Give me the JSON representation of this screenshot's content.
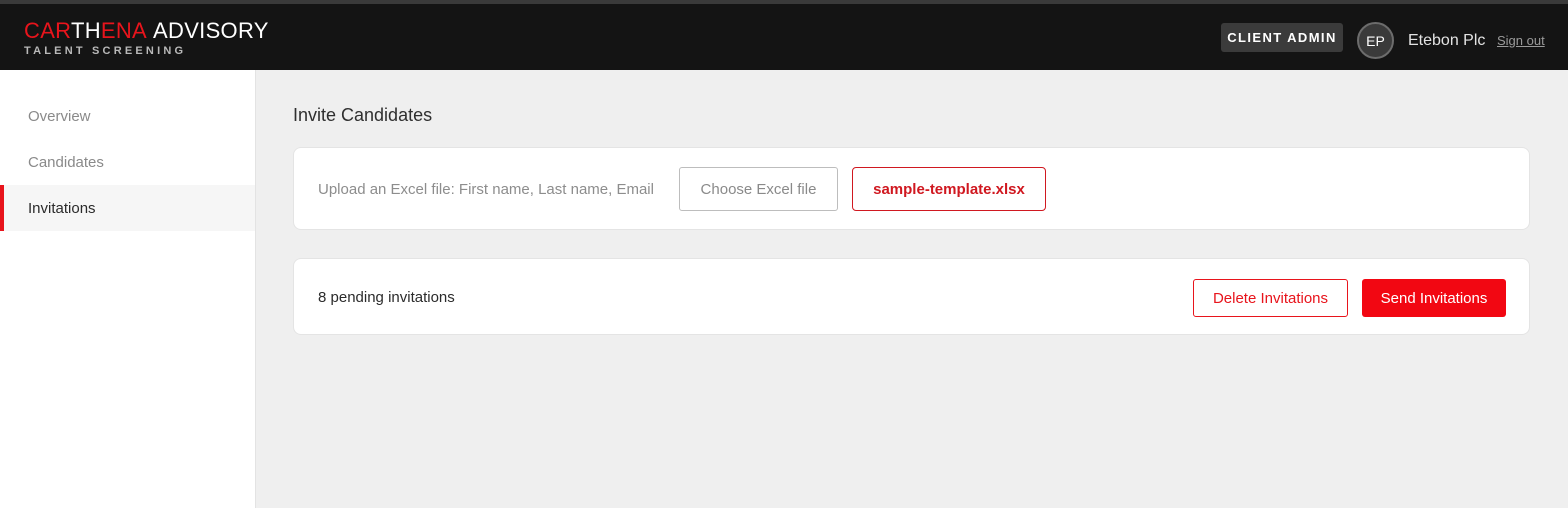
{
  "brand": {
    "name_part1": "CAR",
    "name_part2": "TH",
    "name_part3": "ENA",
    "name_suffix": "ADVISORY",
    "tagline": "TALENT SCREENING"
  },
  "header": {
    "role_badge": "CLIENT ADMIN",
    "avatar_initials": "EP",
    "company": "Etebon Plc",
    "sign_out": "Sign out"
  },
  "sidebar": {
    "items": [
      {
        "label": "Overview",
        "active": false
      },
      {
        "label": "Candidates",
        "active": false
      },
      {
        "label": "Invitations",
        "active": true
      }
    ]
  },
  "main": {
    "title": "Invite Candidates",
    "upload": {
      "label": "Upload an Excel file: First name, Last name, Email",
      "choose_button": "Choose Excel file",
      "template_button": "sample-template.xlsx"
    },
    "pending": {
      "text": "8 pending invitations",
      "delete_button": "Delete Invitations",
      "send_button": "Send Invitations"
    }
  },
  "colors": {
    "accent": "#e8141c",
    "topbar": "#141414",
    "background": "#efefef"
  }
}
